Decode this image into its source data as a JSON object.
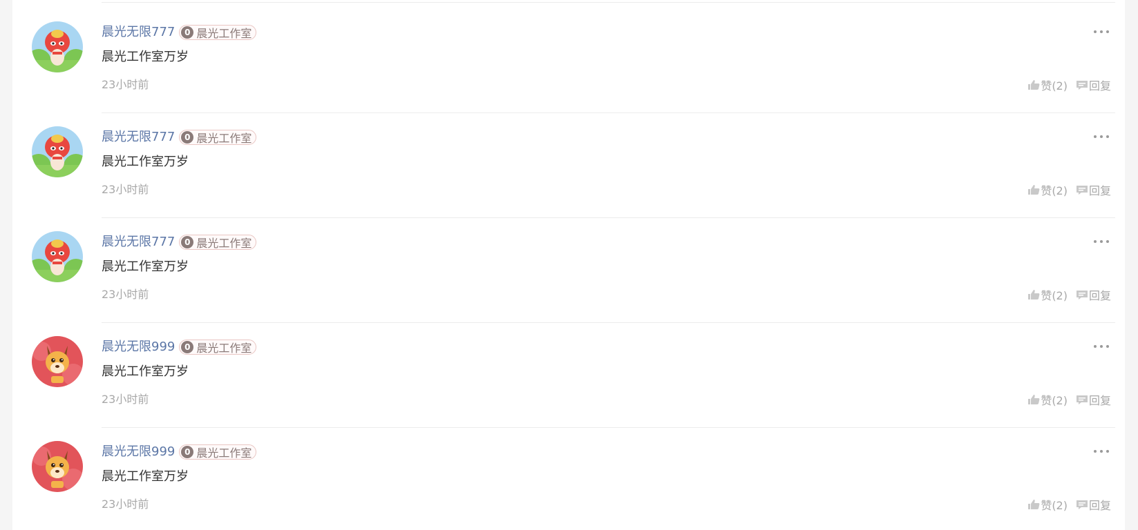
{
  "comments": [
    {
      "username": "晨光无限777",
      "badge_level": "0",
      "badge_text": "晨光工作室",
      "text": "晨光工作室万岁",
      "time": "23小时前",
      "like_label": "赞(2)",
      "reply_label": "回复",
      "avatar": "dog-hero-avatar"
    },
    {
      "username": "晨光无限777",
      "badge_level": "0",
      "badge_text": "晨光工作室",
      "text": "晨光工作室万岁",
      "time": "23小时前",
      "like_label": "赞(2)",
      "reply_label": "回复",
      "avatar": "dog-hero-avatar"
    },
    {
      "username": "晨光无限777",
      "badge_level": "0",
      "badge_text": "晨光工作室",
      "text": "晨光工作室万岁",
      "time": "23小时前",
      "like_label": "赞(2)",
      "reply_label": "回复",
      "avatar": "dog-hero-avatar"
    },
    {
      "username": "晨光无限999",
      "badge_level": "0",
      "badge_text": "晨光工作室",
      "text": "晨光工作室万岁",
      "time": "23小时前",
      "like_label": "赞(2)",
      "reply_label": "回复",
      "avatar": "deer-avatar"
    },
    {
      "username": "晨光无限999",
      "badge_level": "0",
      "badge_text": "晨光工作室",
      "text": "晨光工作室万岁",
      "time": "23小时前",
      "like_label": "赞(2)",
      "reply_label": "回复",
      "avatar": "deer-avatar"
    }
  ],
  "colors": {
    "username": "#5b76a6",
    "badge_border": "#e9c6c3",
    "badge_fill": "#8a7a78",
    "muted": "#a8a8a8",
    "text": "#333333"
  }
}
